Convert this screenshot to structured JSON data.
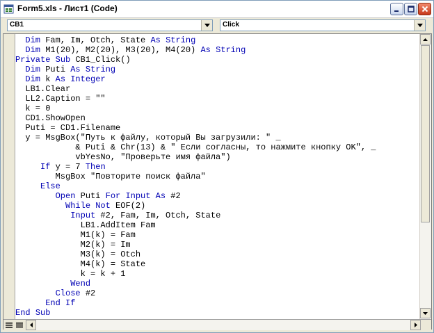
{
  "window": {
    "title": "Form5.xls - Лист1 (Code)"
  },
  "object_box": {
    "value": "CB1"
  },
  "procedure_box": {
    "value": "Click"
  },
  "code_lines": [
    [
      {
        "t": "  "
      },
      {
        "t": "Dim",
        "k": 1
      },
      {
        "t": " Fam, Im, Otch, State "
      },
      {
        "t": "As",
        "k": 1
      },
      {
        "t": " "
      },
      {
        "t": "String",
        "k": 1
      }
    ],
    [
      {
        "t": "  "
      },
      {
        "t": "Dim",
        "k": 1
      },
      {
        "t": " M1(20), M2(20), M3(20), M4(20) "
      },
      {
        "t": "As",
        "k": 1
      },
      {
        "t": " "
      },
      {
        "t": "String",
        "k": 1
      }
    ],
    [
      {
        "t": "Private",
        "k": 1
      },
      {
        "t": " "
      },
      {
        "t": "Sub",
        "k": 1
      },
      {
        "t": " CB1_Click()"
      }
    ],
    [
      {
        "t": "  "
      },
      {
        "t": "Dim",
        "k": 1
      },
      {
        "t": " Puti "
      },
      {
        "t": "As",
        "k": 1
      },
      {
        "t": " "
      },
      {
        "t": "String",
        "k": 1
      }
    ],
    [
      {
        "t": "  "
      },
      {
        "t": "Dim",
        "k": 1
      },
      {
        "t": " k "
      },
      {
        "t": "As",
        "k": 1
      },
      {
        "t": " "
      },
      {
        "t": "Integer",
        "k": 1
      }
    ],
    [
      {
        "t": "  LB1.Clear"
      }
    ],
    [
      {
        "t": "  LL2.Caption = \"\""
      }
    ],
    [
      {
        "t": "  k = 0"
      }
    ],
    [
      {
        "t": "  CD1.ShowOpen"
      }
    ],
    [
      {
        "t": "  Puti = CD1.Filename"
      }
    ],
    [
      {
        "t": "  y = MsgBox(\"Путь к файлу, который Вы загрузили: \" _"
      }
    ],
    [
      {
        "t": "            & Puti & Chr(13) & \" Если согласны, то нажмите кнопку OK\", _"
      }
    ],
    [
      {
        "t": "            vbYesNo, \"Проверьте имя файла\")"
      }
    ],
    [
      {
        "t": "     "
      },
      {
        "t": "If",
        "k": 1
      },
      {
        "t": " y = 7 "
      },
      {
        "t": "Then",
        "k": 1
      }
    ],
    [
      {
        "t": "        MsgBox \"Повторите поиск файла\""
      }
    ],
    [
      {
        "t": "     "
      },
      {
        "t": "Else",
        "k": 1
      }
    ],
    [
      {
        "t": "        "
      },
      {
        "t": "Open",
        "k": 1
      },
      {
        "t": " Puti "
      },
      {
        "t": "For",
        "k": 1
      },
      {
        "t": " "
      },
      {
        "t": "Input",
        "k": 1
      },
      {
        "t": " "
      },
      {
        "t": "As",
        "k": 1
      },
      {
        "t": " #2"
      }
    ],
    [
      {
        "t": "          "
      },
      {
        "t": "While",
        "k": 1
      },
      {
        "t": " "
      },
      {
        "t": "Not",
        "k": 1
      },
      {
        "t": " EOF(2)"
      }
    ],
    [
      {
        "t": "           "
      },
      {
        "t": "Input",
        "k": 1
      },
      {
        "t": " #2, Fam, Im, Otch, State"
      }
    ],
    [
      {
        "t": "             LB1.AddItem Fam"
      }
    ],
    [
      {
        "t": "             M1(k) = Fam"
      }
    ],
    [
      {
        "t": "             M2(k) = Im"
      }
    ],
    [
      {
        "t": "             M3(k) = Otch"
      }
    ],
    [
      {
        "t": "             M4(k) = State"
      }
    ],
    [
      {
        "t": "             k = k + 1"
      }
    ],
    [
      {
        "t": "           "
      },
      {
        "t": "Wend",
        "k": 1
      }
    ],
    [
      {
        "t": "        "
      },
      {
        "t": "Close",
        "k": 1
      },
      {
        "t": " #2"
      }
    ],
    [
      {
        "t": "      "
      },
      {
        "t": "End",
        "k": 1
      },
      {
        "t": " "
      },
      {
        "t": "If",
        "k": 1
      }
    ],
    [
      {
        "t": "End",
        "k": 1
      },
      {
        "t": " "
      },
      {
        "t": "Sub",
        "k": 1
      }
    ]
  ],
  "colors": {
    "keyword": "#0000b4",
    "text": "#000000"
  },
  "icons": {
    "app": "excel-code-window-icon",
    "minimize": "minimize-icon",
    "maximize": "maximize-icon",
    "close": "close-icon",
    "dropdown": "chevron-down-icon",
    "procedure_view": "procedure-view-icon",
    "full_module_view": "full-module-view-icon"
  }
}
